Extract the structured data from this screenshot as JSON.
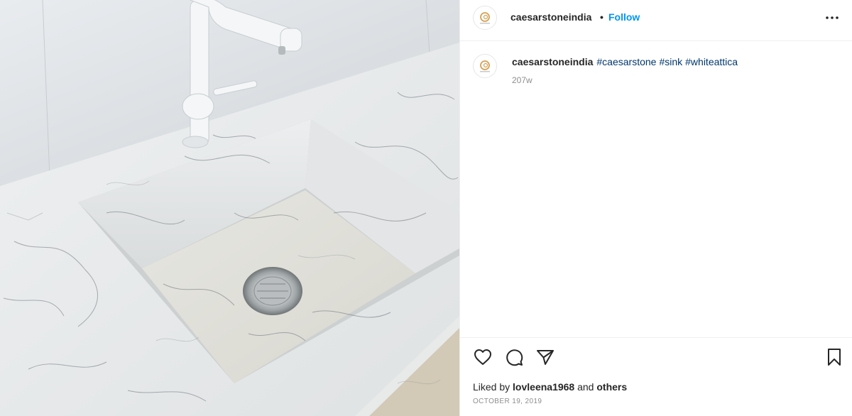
{
  "post": {
    "image_alt": "White quartz sink with a white pull-out faucet",
    "author": {
      "username": "caesarstoneindia",
      "avatar_icon": "caesarstone-logo-icon"
    },
    "header": {
      "separator": "•",
      "follow_label": "Follow",
      "more_icon": "more-options-icon"
    },
    "caption": {
      "username": "caesarstoneindia",
      "hashtags": [
        "#caesarstone",
        "#sink",
        "#whiteattica"
      ],
      "time_ago": "207w"
    },
    "actions": {
      "like_icon": "heart-icon",
      "comment_icon": "comment-icon",
      "share_icon": "send-icon",
      "save_icon": "bookmark-icon"
    },
    "likes": {
      "prefix": "Liked by",
      "user": "lovleena1968",
      "conjunction": "and",
      "others": "others"
    },
    "date": "OCTOBER 19, 2019"
  },
  "colors": {
    "follow": "#0095f6",
    "hashtag": "#00376b",
    "muted": "#8e8e8e",
    "text": "#262626"
  }
}
